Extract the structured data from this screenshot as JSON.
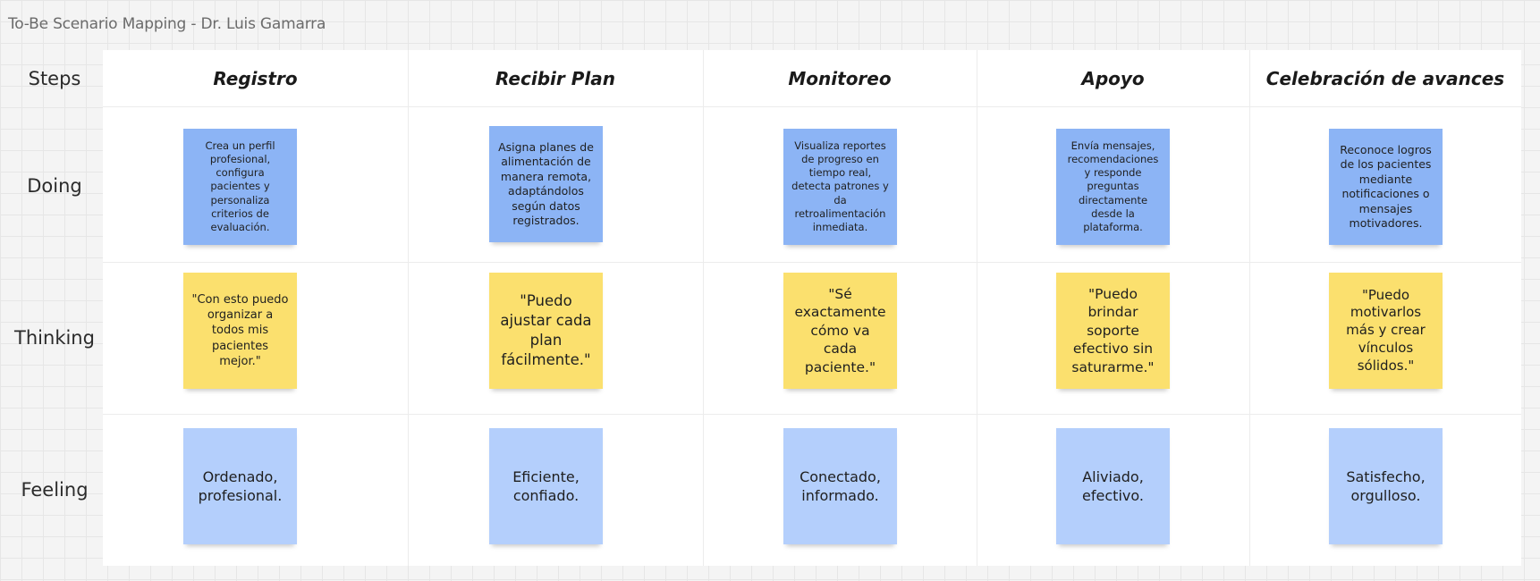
{
  "board_title": "To-Be Scenario Mapping - Dr. Luis Gamarra",
  "rows": {
    "steps": "Steps",
    "doing": "Doing",
    "thinking": "Thinking",
    "feeling": "Feeling"
  },
  "columns": [
    {
      "header": "Registro",
      "doing": "Crea un perfil profesional, configura pacientes y personaliza criterios de evaluación.",
      "thinking": "\"Con esto puedo organizar a todos mis pacientes mejor.\"",
      "feeling": "Ordenado, profesional."
    },
    {
      "header": "Recibir Plan",
      "doing": "Asigna planes de alimentación de manera remota, adaptándolos según datos registrados.",
      "thinking": "\"Puedo ajustar cada plan fácilmente.\"",
      "feeling": "Eficiente, confiado."
    },
    {
      "header": "Monitoreo",
      "doing": "Visualiza reportes de progreso en tiempo real, detecta patrones y da retroalimentación inmediata.",
      "thinking": "\"Sé exactamente cómo va cada paciente.\"",
      "feeling": "Conectado, informado."
    },
    {
      "header": "Apoyo",
      "doing": "Envía mensajes, recomendaciones y responde preguntas directamente desde la plataforma.",
      "thinking": "\"Puedo brindar soporte efectivo sin saturarme.\"",
      "feeling": "Aliviado, efectivo."
    },
    {
      "header": "Celebración de avances",
      "doing": "Reconoce logros de los pacientes mediante notificaciones o mensajes motivadores.",
      "thinking": "\"Puedo motivarlos más y crear vínculos sólidos.\"",
      "feeling": "Satisfecho, orgulloso."
    }
  ],
  "colors": {
    "doing_sticky": "#8cb4f5",
    "thinking_sticky": "#fbe06e",
    "feeling_sticky": "#b4cffc",
    "canvas": "#f4f4f4",
    "frame": "#ffffff"
  }
}
